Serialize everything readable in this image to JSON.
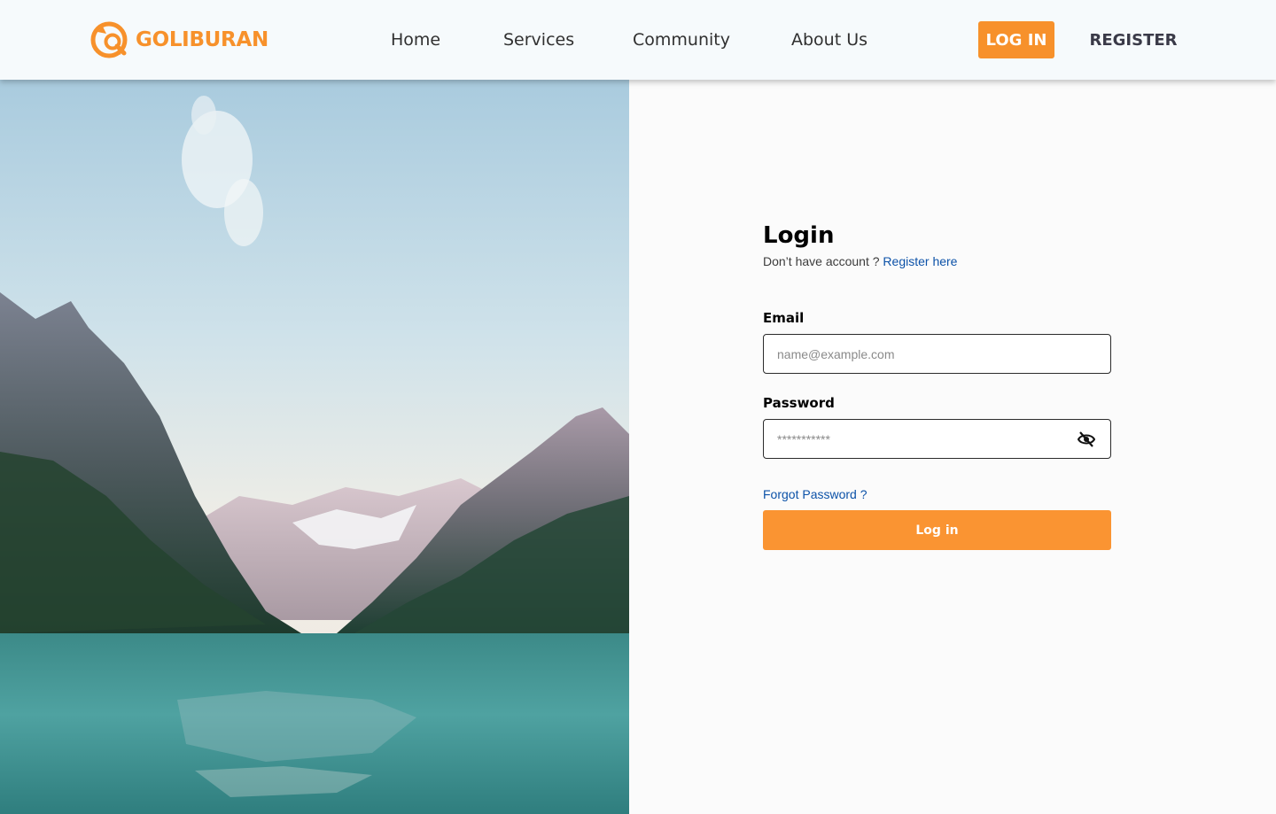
{
  "brand": {
    "logo_text": "GOLIBURAN",
    "accent_color": "#f7912b"
  },
  "nav": {
    "links": [
      {
        "label": "Home"
      },
      {
        "label": "Services"
      },
      {
        "label": "Community"
      },
      {
        "label": "About Us"
      }
    ],
    "login_label": "LOG IN",
    "register_label": "REGISTER"
  },
  "hero": {
    "image_icon": "mountain-lake-photo"
  },
  "login_form": {
    "title": "Login",
    "subtitle": "Don’t have account ?",
    "register_link": "Register here",
    "email": {
      "label": "Email",
      "placeholder": "name@example.com",
      "value": ""
    },
    "password": {
      "label": "Password",
      "placeholder": "***********",
      "value": "",
      "toggle_icon": "eye-off-icon"
    },
    "forgot_link": "Forgot Password ?",
    "submit_label": "Log in",
    "link_color": "#0c52a8",
    "button_color": "#fa9432"
  }
}
